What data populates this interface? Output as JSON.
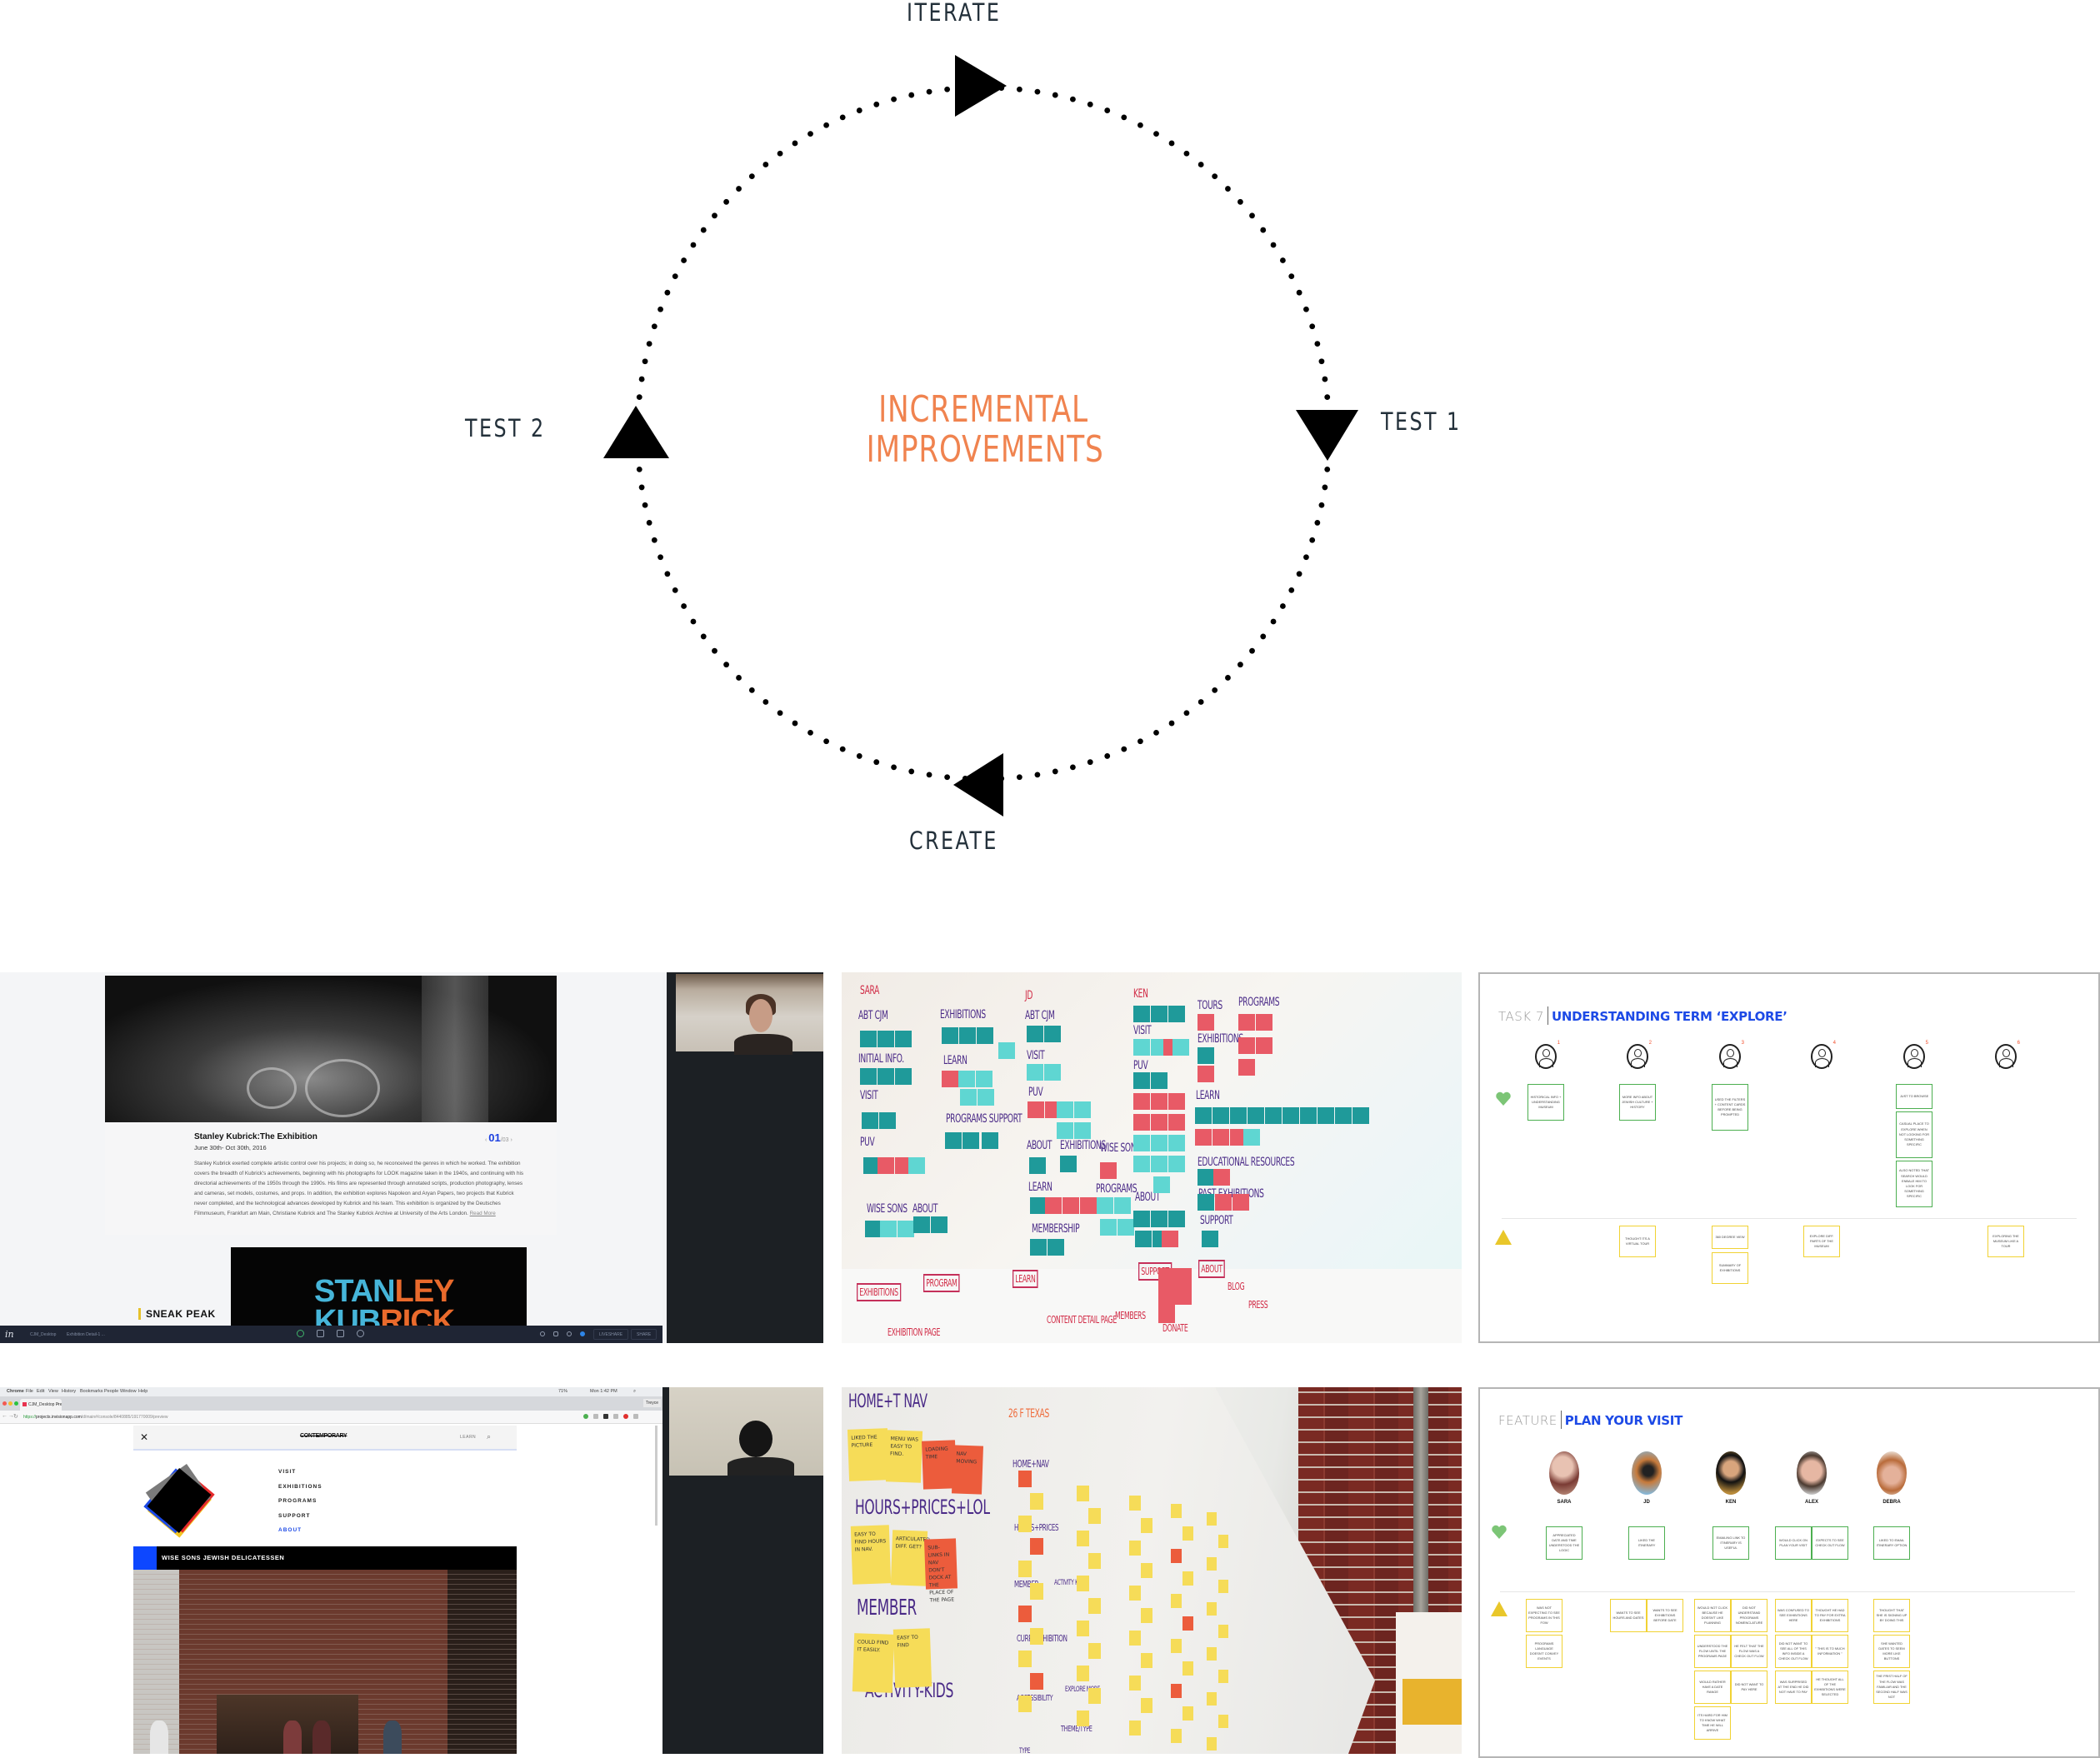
{
  "cycle": {
    "center_label_line1": "INCREMENTAL",
    "center_label_line2": "IMPROVEMENTS",
    "stages": [
      {
        "label": "ITERATE",
        "position": "top",
        "arrow_direction": "right"
      },
      {
        "label": "TEST 1",
        "position": "right",
        "arrow_direction": "down"
      },
      {
        "label": "CREATE",
        "position": "bottom",
        "arrow_direction": "left"
      },
      {
        "label": "TEST 2",
        "position": "left",
        "arrow_direction": "up"
      }
    ],
    "colors": {
      "center_text": "#f0834f",
      "labels": "#23303a",
      "arrows": "#000000"
    }
  },
  "screens": {
    "exhibition_test": {
      "exhibition_title": "Stanley Kubrick:The Exhibition",
      "exhibition_dates": "June 30th- Oct 30th, 2016",
      "pager_current": "01",
      "pager_total": "/03",
      "pager_prev": "‹",
      "pager_next": "›",
      "body": "Stanley Kubrick exerted complete artistic control over his projects; in doing so, he reconceived the genres in which he worked. The exhibition covers the breadth of Kubrick's achievements, beginning with his photographs for LOOK magazine taken in the 1940s, and continuing with his directorial achievements of the 1950s through the 1990s. His films are represented through annotated scripts, production photography, lenses and cameras, set models, costumes, and props. In addition, the exhibition explores Napoleon and Aryan Papers, two projects that Kubrick never completed, and the technological advances developed by Kubrick and his team. This exhibition is organized by the Deutsches Filmmuseum, Frankfurt am Main, Christiane Kubrick and The Stanley Kubrick Archive at University of the Arts London.",
      "read_more": "Read More",
      "video_line1_a": "STAN",
      "video_line1_b": "LEY",
      "video_line2_a": "KUB",
      "video_line2_b": "RICK",
      "sneak_peak": "SNEAK PEAK",
      "toolbar": {
        "logo": "in",
        "crumb1": "CJM_Desktop",
        "crumb2": "Exhibition Detail-1 ...",
        "liveshare": "LIVESHARE",
        "share": "SHARE"
      }
    },
    "nav_test": {
      "menubar": [
        "Chrome",
        "File",
        "Edit",
        "View",
        "History",
        "Bookmarks",
        "People",
        "Window",
        "Help"
      ],
      "status_battery": "71%",
      "status_time": "Mon 1:42 PM",
      "tab_title": "CJM_Desktop Preview Mode",
      "tab_close": "×",
      "profile": "Treyce",
      "url_scheme": "https://",
      "url_host": "projects.invisionapp.com",
      "url_path": "/d/main#/console/8440885/191770009/preview",
      "site": {
        "close": "✕",
        "brand": "CONTEMPORARY",
        "learn": "LEARN",
        "search_icon": "⌕",
        "menu": [
          "VISIT",
          "EXHIBITIONS",
          "PROGRAMS",
          "SUPPORT",
          "ABOUT"
        ],
        "active_menu": "ABOUT",
        "feature_title": "WISE SONS JEWISH DELICATESSEN"
      }
    }
  },
  "whiteboard_teal": {
    "headings": [
      {
        "text": "SARA",
        "color": "red"
      },
      {
        "text": "ABT CJM"
      },
      {
        "text": "INITIAL INFO."
      },
      {
        "text": "VISIT"
      },
      {
        "text": "PUV"
      },
      {
        "text": "WISE SONS"
      },
      {
        "text": "ABOUT"
      },
      {
        "text": "EXHIBITIONS"
      },
      {
        "text": "LEARN"
      },
      {
        "text": "PROGRAMS SUPPORT"
      },
      {
        "text": "JD",
        "color": "red"
      },
      {
        "text": "ABT CJM"
      },
      {
        "text": "VISIT"
      },
      {
        "text": "PUV"
      },
      {
        "text": "ABOUT"
      },
      {
        "text": "EXHIBITIONS"
      },
      {
        "text": "WISE SONS"
      },
      {
        "text": "LEARN"
      },
      {
        "text": "MEMBERSHIP"
      },
      {
        "text": "PROGRAMS"
      },
      {
        "text": "KEN",
        "color": "red"
      },
      {
        "text": "VISIT"
      },
      {
        "text": "PUV"
      },
      {
        "text": "ABOUT"
      },
      {
        "text": "TOURS"
      },
      {
        "text": "PROGRAMS"
      },
      {
        "text": "EXHIBITIONS"
      },
      {
        "text": "LEARN"
      },
      {
        "text": "EDUCATIONAL RESOURCES"
      },
      {
        "text": "PAST EXHIBITIONS"
      },
      {
        "text": "SUPPORT"
      }
    ],
    "paper_labels": [
      "EXHIBITIONS",
      "PROGRAM",
      "LEARN",
      "SUPPORT",
      "ABOUT",
      "MEMBERS",
      "DONATE",
      "BLOG",
      "PRESS",
      "EXHIBITION PAGE",
      "CONTENT DETAIL PAGE"
    ]
  },
  "whiteboard_yellow": {
    "headings": [
      "HOME+T NAV",
      "HOURS+PRICES+LOL",
      "MEMBER",
      "ACTIVITY-KIDS",
      "26 F TEXAS",
      "HOME+NAV",
      "HOURS+PRICES",
      "MEMBER",
      "ACTIVITY KIDS",
      "CURR. EXHIBITION",
      "ACCESSIBILITY",
      "EXPLORE MORE",
      "THEME/TYPE",
      "TYPE"
    ],
    "notes": [
      {
        "text": "LIKED THE PICTURE",
        "color": "yellow"
      },
      {
        "text": "MENU WAS EASY TO FIND.",
        "color": "yellow"
      },
      {
        "text": "LOADING TIME",
        "color": "red"
      },
      {
        "text": "NAV MOVING",
        "color": "red"
      },
      {
        "text": "EASY TO FIND HOURS IN NAV.",
        "color": "yellow"
      },
      {
        "text": "ARTICULATED DIFF. GET?",
        "color": "yellow"
      },
      {
        "text": "SUB-LINKS IN NAV DON'T DOCK AT THE PLACE OF THE PAGE",
        "color": "red"
      },
      {
        "text": "COULD FIND IT EASILY.",
        "color": "yellow"
      },
      {
        "text": "EASY TO FIND",
        "color": "yellow"
      }
    ]
  },
  "affinity_task7": {
    "prefix": "TASK 7",
    "title": "UNDERSTANDING TERM ‘EXPLORE’",
    "personas": [
      "1",
      "2",
      "3",
      "4",
      "5",
      "6"
    ],
    "positive": [
      {
        "persona": 1,
        "notes": [
          "HISTORICAL INFO + UNDERSTANDING MUSEUM"
        ]
      },
      {
        "persona": 2,
        "notes": [
          "MORE INFO ABOUT JEWISH CULTURE + HISTORY"
        ]
      },
      {
        "persona": 3,
        "notes": [
          "USED THE FILTERS + CONTENT CARDS BEFORE BEING PROMPTED"
        ]
      },
      {
        "persona": 5,
        "notes": [
          "JUST TO BROWSE",
          "CASUAL PLACE TO EXPLORE WHEN NOT LOOKING FOR SOMETHING SPECIFIC",
          "ALSO NOTED THAT SEARCH WOULD ENBALE HIM TO LOOK FOR SOMETHING SPECIFIC"
        ]
      }
    ],
    "issues": [
      {
        "persona": 2,
        "notes": [
          "THOUGHT ITS A VIRTUAL TOUR"
        ]
      },
      {
        "persona": 3,
        "notes": [
          "360 DEGREE VIEW",
          "SUMMARY OF EXHIBITIONS"
        ]
      },
      {
        "persona": 4,
        "notes": [
          "EXPLORE DIFF. PARTS OF THE MUSEUM"
        ]
      },
      {
        "persona": 6,
        "notes": [
          "EXPLORING THE MUSEUM LIKE A TOUR"
        ]
      }
    ],
    "colors": {
      "accent": "#1d4ae6",
      "positive": "#4caf50",
      "issue": "#e9c72a",
      "heart": "#7cc576"
    }
  },
  "affinity_plan_visit": {
    "prefix": "FEATURE",
    "title": "PLAN YOUR VISIT",
    "personas": [
      {
        "name": "SARA",
        "positive": [
          "APPRECIATED DATE AND TIME UNDERSTOOD THE LOGIC"
        ],
        "issues": [
          "WAS NOT EXPECTING TO SEE PROGRAMS IN THIS FOW",
          "PROGRAMS LANGUAGE DOESN'T CONVEY EVENTS"
        ]
      },
      {
        "name": "JD",
        "positive": [
          "LIKED THE ITINERARY"
        ],
        "issues": [
          "WANTS TO SEE HOURS AND DATES",
          "WANTS TO SEE EXHIBITIONS BEFORE DATE"
        ]
      },
      {
        "name": "KEN",
        "positive": [
          "EMAILING LINK TO ITINERARY IS USEFUL"
        ],
        "issues": [
          "WOULD NOT CLICK BECAUSE HE DOESN'T LIKE PLANNING",
          "DID NOT UNDERSTAND PROGRAMS NOMENCLATURE",
          "UNDERSTOOD THE FLOW UNTIL THE PROGRAMS PAGE",
          "HE FELT THAT THE FLOW WAS A CHECK OUT FLOW",
          "WOULD RATHER HAVE A DATE RANGE",
          "DID NOT WANT TO PAY HERE",
          "ITS HARD FOR HIM TO KNOW WHAT TIME HE WILL ARRIVE"
        ]
      },
      {
        "name": "ALEX",
        "positive": [
          "WOULD CLICK ON PLAN YOUR VISIT",
          "EXPECTS TO SEE CHECK OUT FLOW"
        ],
        "issues": [
          "WAS CONFUSED TO SEE EXHIBITIONS HERE",
          "THOUGHT HE HAD TO PAY FOR EXTRA EXHIBITIONS",
          "DID NOT WANT TO SEE ALL OF THIS INFO INSIDE A CHECK OUT FLOW",
          "\" THIS IS TO MUCH INFORMATION \"",
          "WAS SURPRISED AT THE END HE DID NOT HAVE TO PAY",
          "HE THOUGHT ALL OF THE EXHIBITIONS WERE SELECTED"
        ]
      },
      {
        "name": "DEBRA",
        "positive": [
          "LIKED TO EMAIL ITINERARY OPTION"
        ],
        "issues": [
          "THOUGHT THAT SHE IS SIGNING UP BY DOING THIS",
          "SHE WANTED DATES TO SEEM MORE LIKE BUTTONS",
          "THE FRIST HALF OF THE FLOW WAS FAMILIAR AND THE SECOND HALF WAS NOT"
        ]
      }
    ]
  }
}
